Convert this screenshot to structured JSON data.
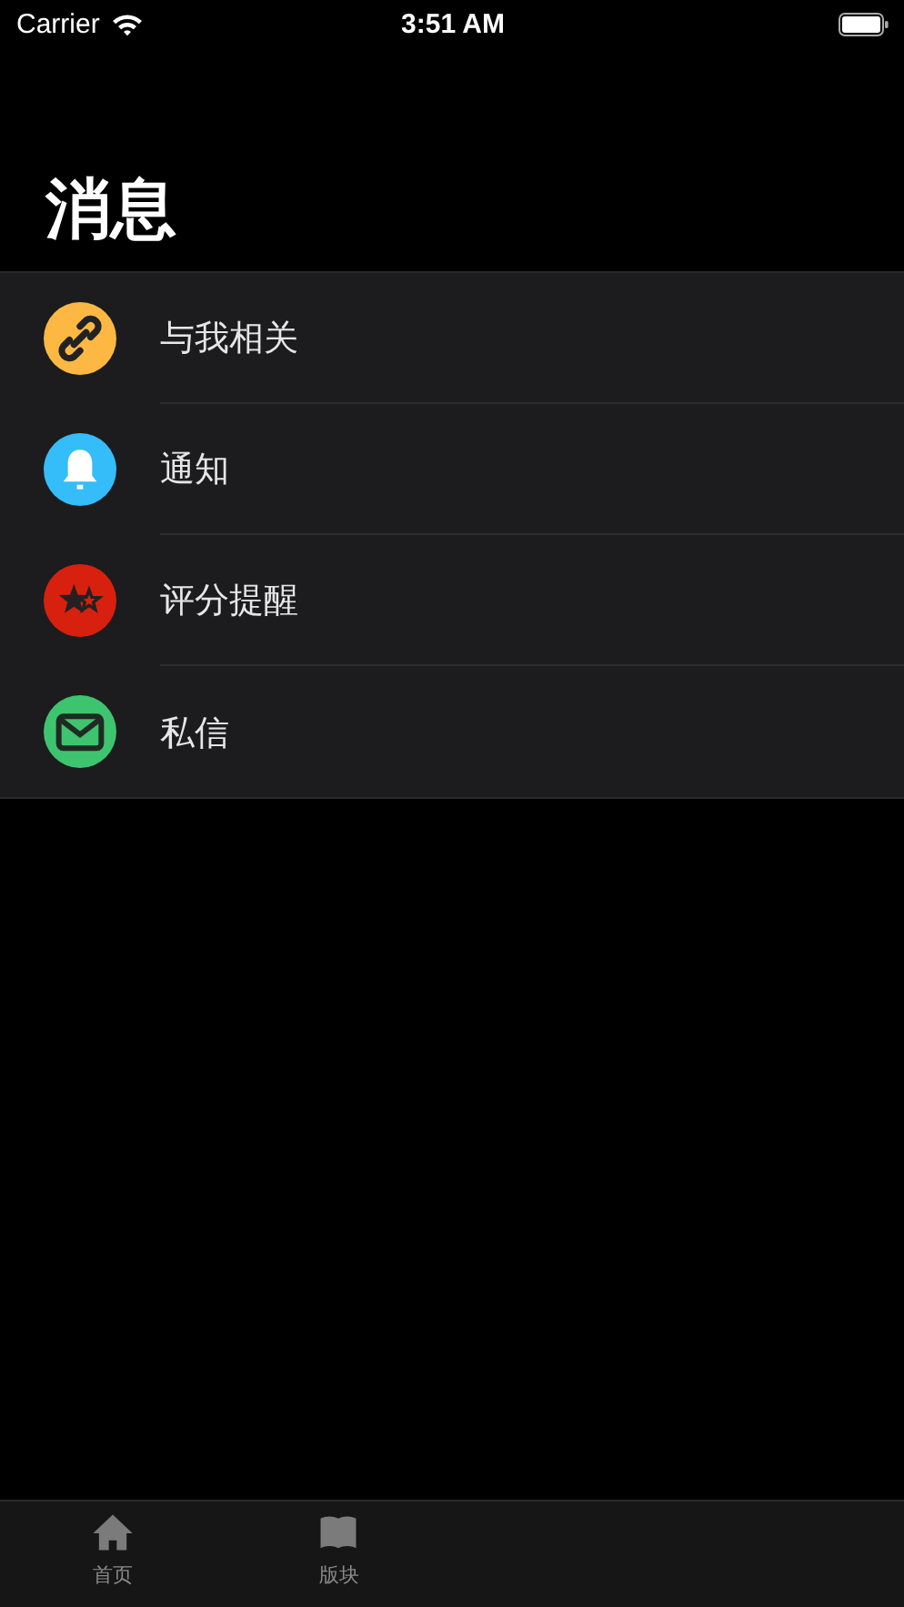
{
  "status_bar": {
    "carrier": "Carrier",
    "time": "3:51 AM"
  },
  "title": "消息",
  "items": [
    {
      "kind": "link",
      "label": "与我相关",
      "color": "#fdb843"
    },
    {
      "kind": "bell",
      "label": "通知",
      "color": "#34bdf8"
    },
    {
      "kind": "stars",
      "label": "评分提醒",
      "color": "#d8200f"
    },
    {
      "kind": "mail",
      "label": "私信",
      "color": "#3ec46f"
    }
  ],
  "tab_bar": [
    {
      "kind": "home",
      "label": "首页",
      "selected": false
    },
    {
      "kind": "book",
      "label": "版块",
      "selected": false
    }
  ]
}
